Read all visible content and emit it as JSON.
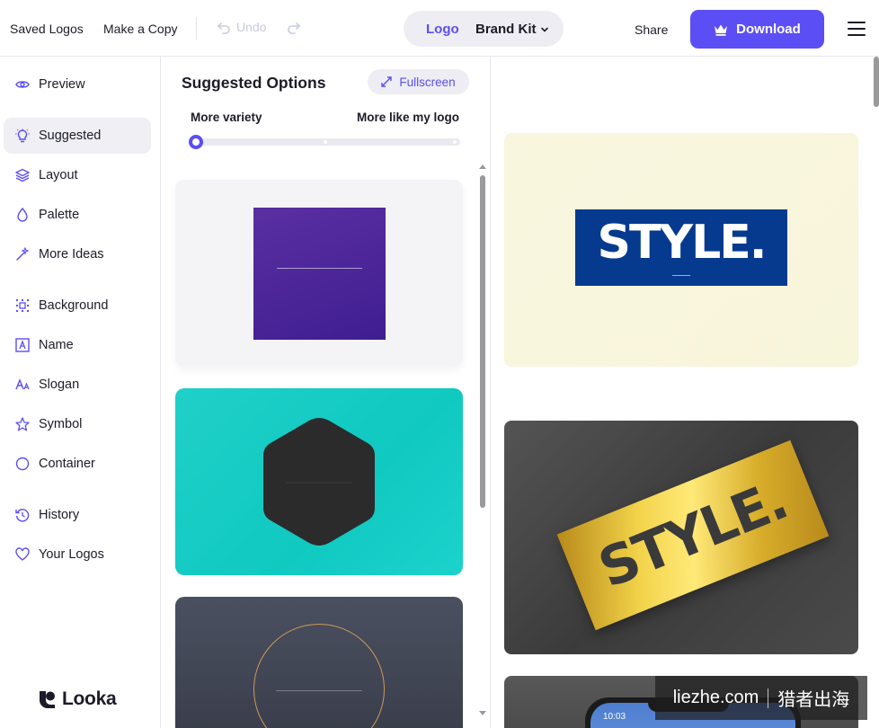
{
  "topbar": {
    "saved_logos": "Saved Logos",
    "make_copy": "Make a Copy",
    "undo": "Undo",
    "toggle": {
      "logo": "Logo",
      "brand_kit": "Brand Kit"
    },
    "share": "Share",
    "download": "Download"
  },
  "sidebar": {
    "items": [
      {
        "label": "Preview",
        "icon": "eye-icon"
      },
      {
        "label": "Suggested",
        "icon": "lightbulb-icon",
        "active": true
      },
      {
        "label": "Layout",
        "icon": "layers-icon"
      },
      {
        "label": "Palette",
        "icon": "droplet-icon"
      },
      {
        "label": "More Ideas",
        "icon": "magic-wand-icon"
      },
      {
        "label": "Background",
        "icon": "background-grid-icon"
      },
      {
        "label": "Name",
        "icon": "text-box-icon"
      },
      {
        "label": "Slogan",
        "icon": "font-icon"
      },
      {
        "label": "Symbol",
        "icon": "star-icon"
      },
      {
        "label": "Container",
        "icon": "circle-icon"
      },
      {
        "label": "History",
        "icon": "history-icon"
      },
      {
        "label": "Your Logos",
        "icon": "heart-icon"
      }
    ],
    "brand": "Looka"
  },
  "suggested": {
    "title": "Suggested Options",
    "fullscreen": "Fullscreen",
    "slider_left": "More variety",
    "slider_right": "More like my logo",
    "slider_value": 0
  },
  "preview": {
    "logo_text": "STYLE.",
    "phone_time": "10:03"
  },
  "watermark": {
    "left": "liezhe.com",
    "right": "猎者出海"
  },
  "colors": {
    "accent": "#5b4ef5",
    "teal": "#10c9c1",
    "navy": "#063a8f",
    "purple": "#4a2599"
  }
}
